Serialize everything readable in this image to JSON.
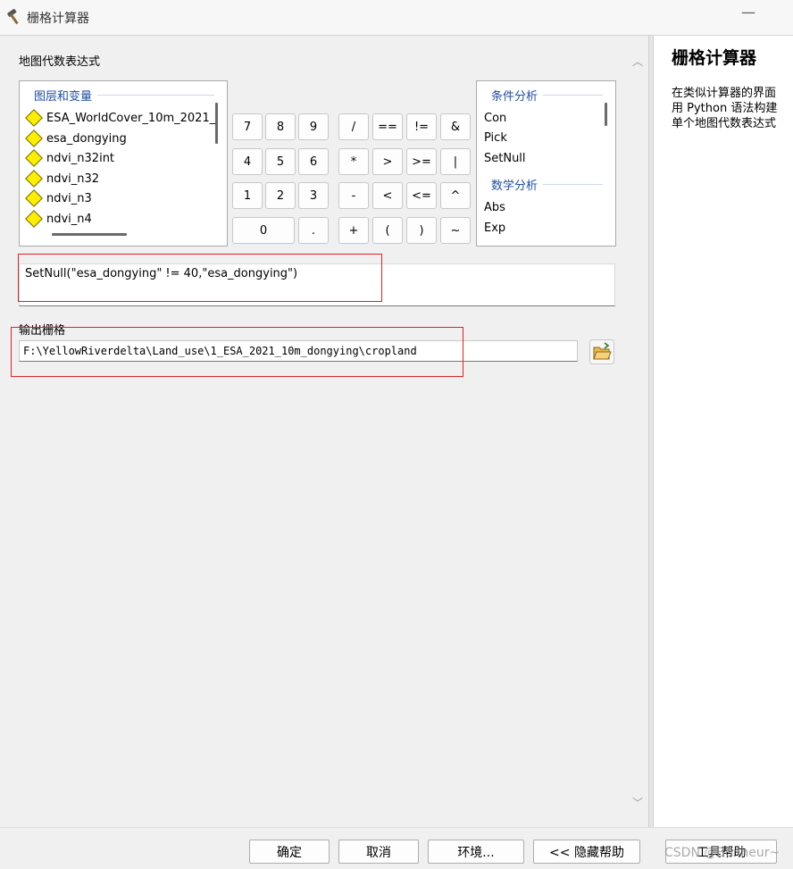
{
  "window": {
    "title": "栅格计算器",
    "minimize_glyph": "—"
  },
  "expression_section": {
    "label": "地图代数表达式"
  },
  "layers": {
    "header": "图层和变量",
    "items": [
      "ESA_WorldCover_10m_2021_",
      "esa_dongying",
      "ndvi_n32int",
      "ndvi_n32",
      "ndvi_n3",
      "ndvi_n4"
    ]
  },
  "keypad": {
    "rows": [
      [
        "7",
        "8",
        "9"
      ],
      [
        "4",
        "5",
        "6"
      ],
      [
        "1",
        "2",
        "3"
      ],
      [
        "0",
        "."
      ]
    ],
    "operators": [
      [
        "/",
        "==",
        "!=",
        "&"
      ],
      [
        "*",
        ">",
        ">=",
        "|"
      ],
      [
        "-",
        "<",
        "<=",
        "^"
      ],
      [
        "+",
        "(",
        ")",
        "~"
      ]
    ]
  },
  "functions": {
    "groups": [
      {
        "header": "条件分析",
        "items": [
          "Con",
          "Pick",
          "SetNull"
        ]
      },
      {
        "header": "数学分析",
        "items": [
          "Abs",
          "Exp"
        ]
      }
    ]
  },
  "expression": {
    "value": "SetNull(\"esa_dongying\" != 40,\"esa_dongying\")"
  },
  "output": {
    "label": "输出栅格",
    "path": "F:\\YellowRiverdelta\\Land_use\\1_ESA_2021_10m_dongying\\cropland"
  },
  "help": {
    "title": "栅格计算器",
    "lines": [
      "在类似计算器的界面",
      "用 Python 语法构建",
      "单个地图代数表达式"
    ]
  },
  "buttons": {
    "ok": "确定",
    "cancel": "取消",
    "env": "环境...",
    "hide_help": "<< 隐藏帮助",
    "tool_help": "工具帮助"
  },
  "watermark": "CSDN @Bonheur~",
  "colors": {
    "accent_blue": "#1f4fa3",
    "highlight_red": "#e02020",
    "layer_diamond": "#ffee00"
  }
}
